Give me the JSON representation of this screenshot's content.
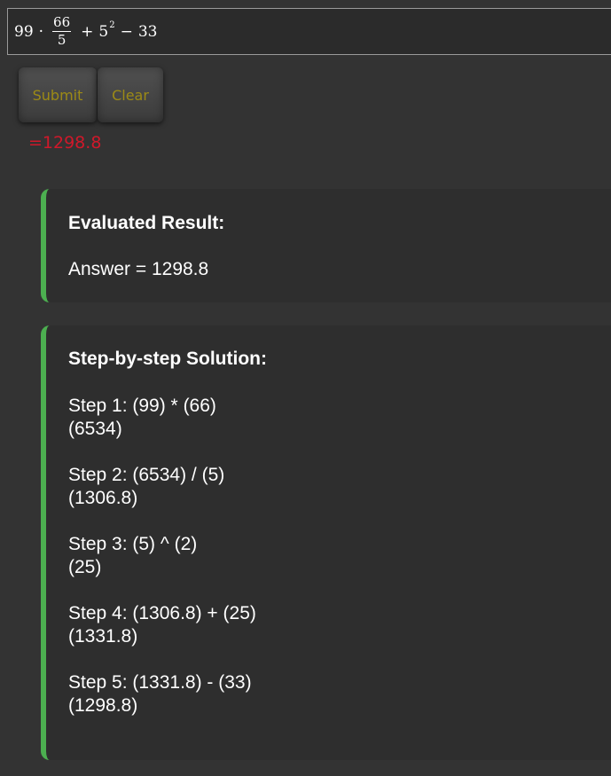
{
  "expression": {
    "left": "99",
    "dot": "·",
    "frac_num": "66",
    "frac_den": "5",
    "plus": "+",
    "base": "5",
    "exponent": "2",
    "minus": "−",
    "right": "33"
  },
  "buttons": {
    "submit": "Submit",
    "clear": "Clear"
  },
  "inline_result": "=1298.8",
  "evaluated": {
    "heading": "Evaluated Result:",
    "answer": "Answer = 1298.8"
  },
  "solution": {
    "heading": "Step-by-step Solution:",
    "steps": [
      {
        "expr": "Step 1: (99) * (66)",
        "value": "(6534)"
      },
      {
        "expr": "Step 2: (6534) / (5)",
        "value": "(1306.8)"
      },
      {
        "expr": "Step 3: (5) ^ (2)",
        "value": "(25)"
      },
      {
        "expr": "Step 4: (1306.8) + (25)",
        "value": "(1331.8)"
      },
      {
        "expr": "Step 5: (1331.8) - (33)",
        "value": "(1298.8)"
      }
    ]
  },
  "colors": {
    "accent": "#4caf50",
    "result_text": "#d0182a",
    "button_text": "#9c8a16",
    "background": "#333333"
  }
}
